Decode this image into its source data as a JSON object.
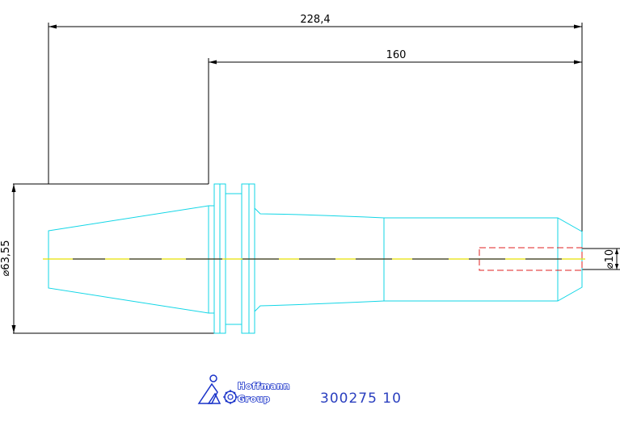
{
  "dimensions": {
    "overall_length": "228,4",
    "gauge_length": "160",
    "flange_diameter": "⌀63,55",
    "tip_diameter": "⌀10"
  },
  "footer": {
    "logo_line1": "Hoffmann",
    "logo_line2": "Group",
    "part_number": "300275 10"
  },
  "colors": {
    "outline": "#12d6e6",
    "dimension": "#000000",
    "hidden_bore": "#e02020",
    "centerline": "#e8e000",
    "title": "#2a3fbf"
  }
}
